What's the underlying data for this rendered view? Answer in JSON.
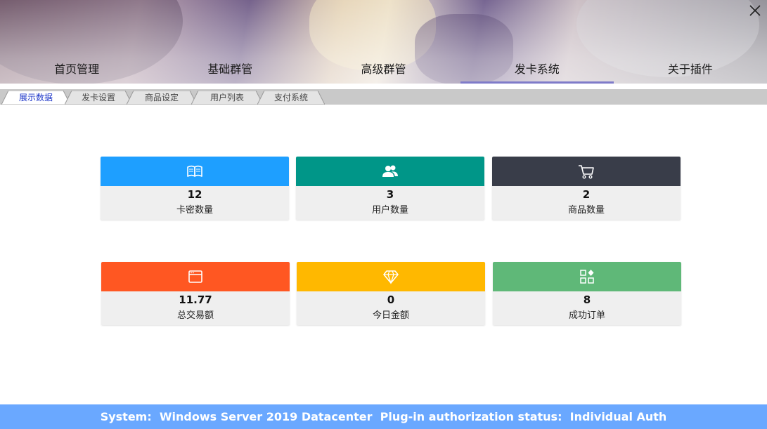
{
  "window": {
    "close_icon": "close-icon"
  },
  "main_nav": [
    {
      "label": "首页管理",
      "active": false
    },
    {
      "label": "基础群管",
      "active": false
    },
    {
      "label": "高级群管",
      "active": false
    },
    {
      "label": "发卡系统",
      "active": true
    },
    {
      "label": "关于插件",
      "active": false
    }
  ],
  "sub_tabs": [
    {
      "label": "展示数据",
      "active": true
    },
    {
      "label": "发卡设置",
      "active": false
    },
    {
      "label": "商品设定",
      "active": false
    },
    {
      "label": "用户列表",
      "active": false
    },
    {
      "label": "支付系统",
      "active": false
    }
  ],
  "stats": [
    {
      "value": "12",
      "label": "卡密数量",
      "color": "#1e9fff",
      "icon": "book-icon"
    },
    {
      "value": "3",
      "label": "用户数量",
      "color": "#009688",
      "icon": "users-icon"
    },
    {
      "value": "2",
      "label": "商品数量",
      "color": "#393d49",
      "icon": "cart-icon"
    },
    {
      "value": "11.77",
      "label": "总交易额",
      "color": "#ff5722",
      "icon": "browser-window-icon"
    },
    {
      "value": "0",
      "label": "今日金额",
      "color": "#ffb800",
      "icon": "diamond-icon"
    },
    {
      "value": "8",
      "label": "成功订单",
      "color": "#5fb878",
      "icon": "apps-grid-icon"
    }
  ],
  "footer": {
    "text": "System:  Windows Server 2019 Datacenter  Plug-in authorization status:  Individual Auth",
    "color": "#6aa8ff"
  }
}
